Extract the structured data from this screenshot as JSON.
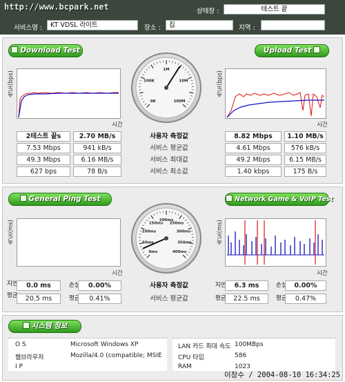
{
  "header": {
    "watermark": "http://www.bcpark.net",
    "status_label": "상태창 :",
    "status_value": "테스트 끝",
    "service_label": "서비스명 :",
    "service_value": "KT VDSL 라이트",
    "place_label": "장소 :",
    "place_value": "집",
    "region_label": "지역 :",
    "region_value": ""
  },
  "speed": {
    "download_button": "Download Test",
    "upload_button": "Upload Test",
    "y_label": "속도(bps)",
    "x_label": "시간",
    "row_labels": [
      "사용자 측정값",
      "서비스 평균값",
      "서비스 최대값",
      "서비스 최소값"
    ],
    "download_rows": [
      [
        "2테스트 끝s",
        "2.70 MB/s"
      ],
      [
        "7.53 Mbps",
        "941 kB/s"
      ],
      [
        "49.3 Mbps",
        "6.16 MB/s"
      ],
      [
        "627 bps",
        "78 B/s"
      ]
    ],
    "upload_rows": [
      [
        "8.82 Mbps",
        "1.10 MB/s"
      ],
      [
        "4.61 Mbps",
        "576 kB/s"
      ],
      [
        "49.2 Mbps",
        "6.15 MB/s"
      ],
      [
        "1.40 kbps",
        "175 B/s"
      ]
    ],
    "gauge_labels": [
      "0K",
      "100K",
      "1M",
      "10M",
      "100M"
    ],
    "gauge_level_fraction": 0.62
  },
  "ping": {
    "ping_button": "General Ping Test",
    "game_button": "Network Game & VoIP Test",
    "y_label": "속도(ms)",
    "x_label": "시간",
    "left_row_side": "지연",
    "left_row_side2": "평균",
    "loss_label": "손실",
    "loss_label2": "평균",
    "right_row_side": "지연",
    "right_row_side2": "평균",
    "row_labels": [
      "사용자 측정값",
      "서비스 평균값"
    ],
    "left_rows": [
      [
        "0.0 ms",
        "0.00%"
      ],
      [
        "20.5 ms",
        "0.41%"
      ]
    ],
    "right_rows": [
      [
        "6.3 ms",
        "0.00%"
      ],
      [
        "22.5 ms",
        "0.47%"
      ]
    ],
    "gauge_labels": [
      "0ms",
      "50ms",
      "100ms",
      "150ms",
      "200ms",
      "250ms",
      "300ms",
      "350ms",
      "400ms"
    ],
    "gauge_level_fraction": 0.08
  },
  "system": {
    "title": "시스템 정보",
    "rows_left": [
      [
        "O S",
        "Microsoft Windows XP"
      ],
      [
        "웹브라우저",
        "Mozilla/4.0 (compatible; MSIE"
      ],
      [
        "I P",
        ""
      ]
    ],
    "rows_right": [
      [
        "LAN 카드 최대 속도",
        "100MBps"
      ],
      [
        "CPU 타입",
        "586"
      ],
      [
        "RAM",
        "1023"
      ]
    ],
    "timestamp": "이창수 / 2004-08-10 16:34:25"
  },
  "colors": {
    "header_bg": "#3d463d",
    "button_green": "#3fae2a",
    "series_red": "#e01010",
    "series_blue": "#1010c0"
  }
}
